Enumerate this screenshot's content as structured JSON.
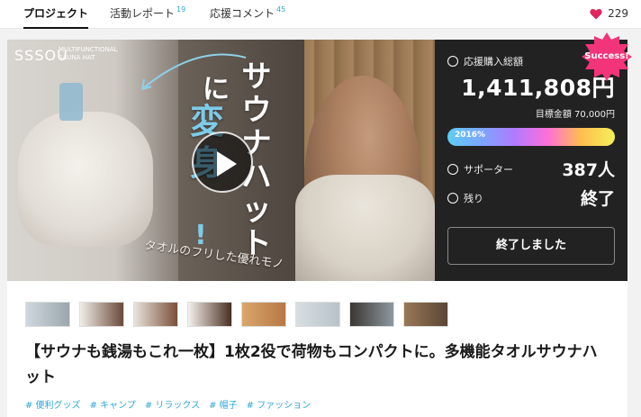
{
  "tabs": [
    {
      "label": "プロジェクト",
      "count": ""
    },
    {
      "label": "活動レポート",
      "count": "19"
    },
    {
      "label": "応援コメント",
      "count": "45"
    }
  ],
  "like_count": "229",
  "hero": {
    "brand": "SSSOU",
    "brand_sub": "MULTIFUNCTIONAL SAUNA HAT",
    "headline_1": "サウナハット",
    "headline_2": "に",
    "headline_3": "変身",
    "headline_4": "!",
    "tagline": "タオルのフリした優れモノ"
  },
  "stats": {
    "badge": "Success!",
    "total_label": "応援購入総額",
    "total_value": "1,411,808円",
    "goal_text": "目標金額 70,000円",
    "progress_text": "2016%",
    "progress_percent": 2016,
    "supporters_label": "サポーター",
    "supporters_value": "387人",
    "remaining_label": "残り",
    "remaining_value": "終了",
    "ended_button": "終了しました"
  },
  "thumbnails": [
    "thumb-1",
    "thumb-2",
    "thumb-3",
    "thumb-4",
    "thumb-5",
    "thumb-6",
    "thumb-7",
    "thumb-8"
  ],
  "title": "【サウナも銭湯もこれ一枚】1枚2役で荷物もコンパクトに。多機能タオルサウナハット",
  "tags": [
    "# 便利グッズ",
    "# キャンプ",
    "# リラックス",
    "# 帽子",
    "# ファッション"
  ],
  "colors": {
    "accent": "#2ea6d6",
    "heart": "#e0245e",
    "badge": "#f2357a",
    "panel": "#222222"
  }
}
